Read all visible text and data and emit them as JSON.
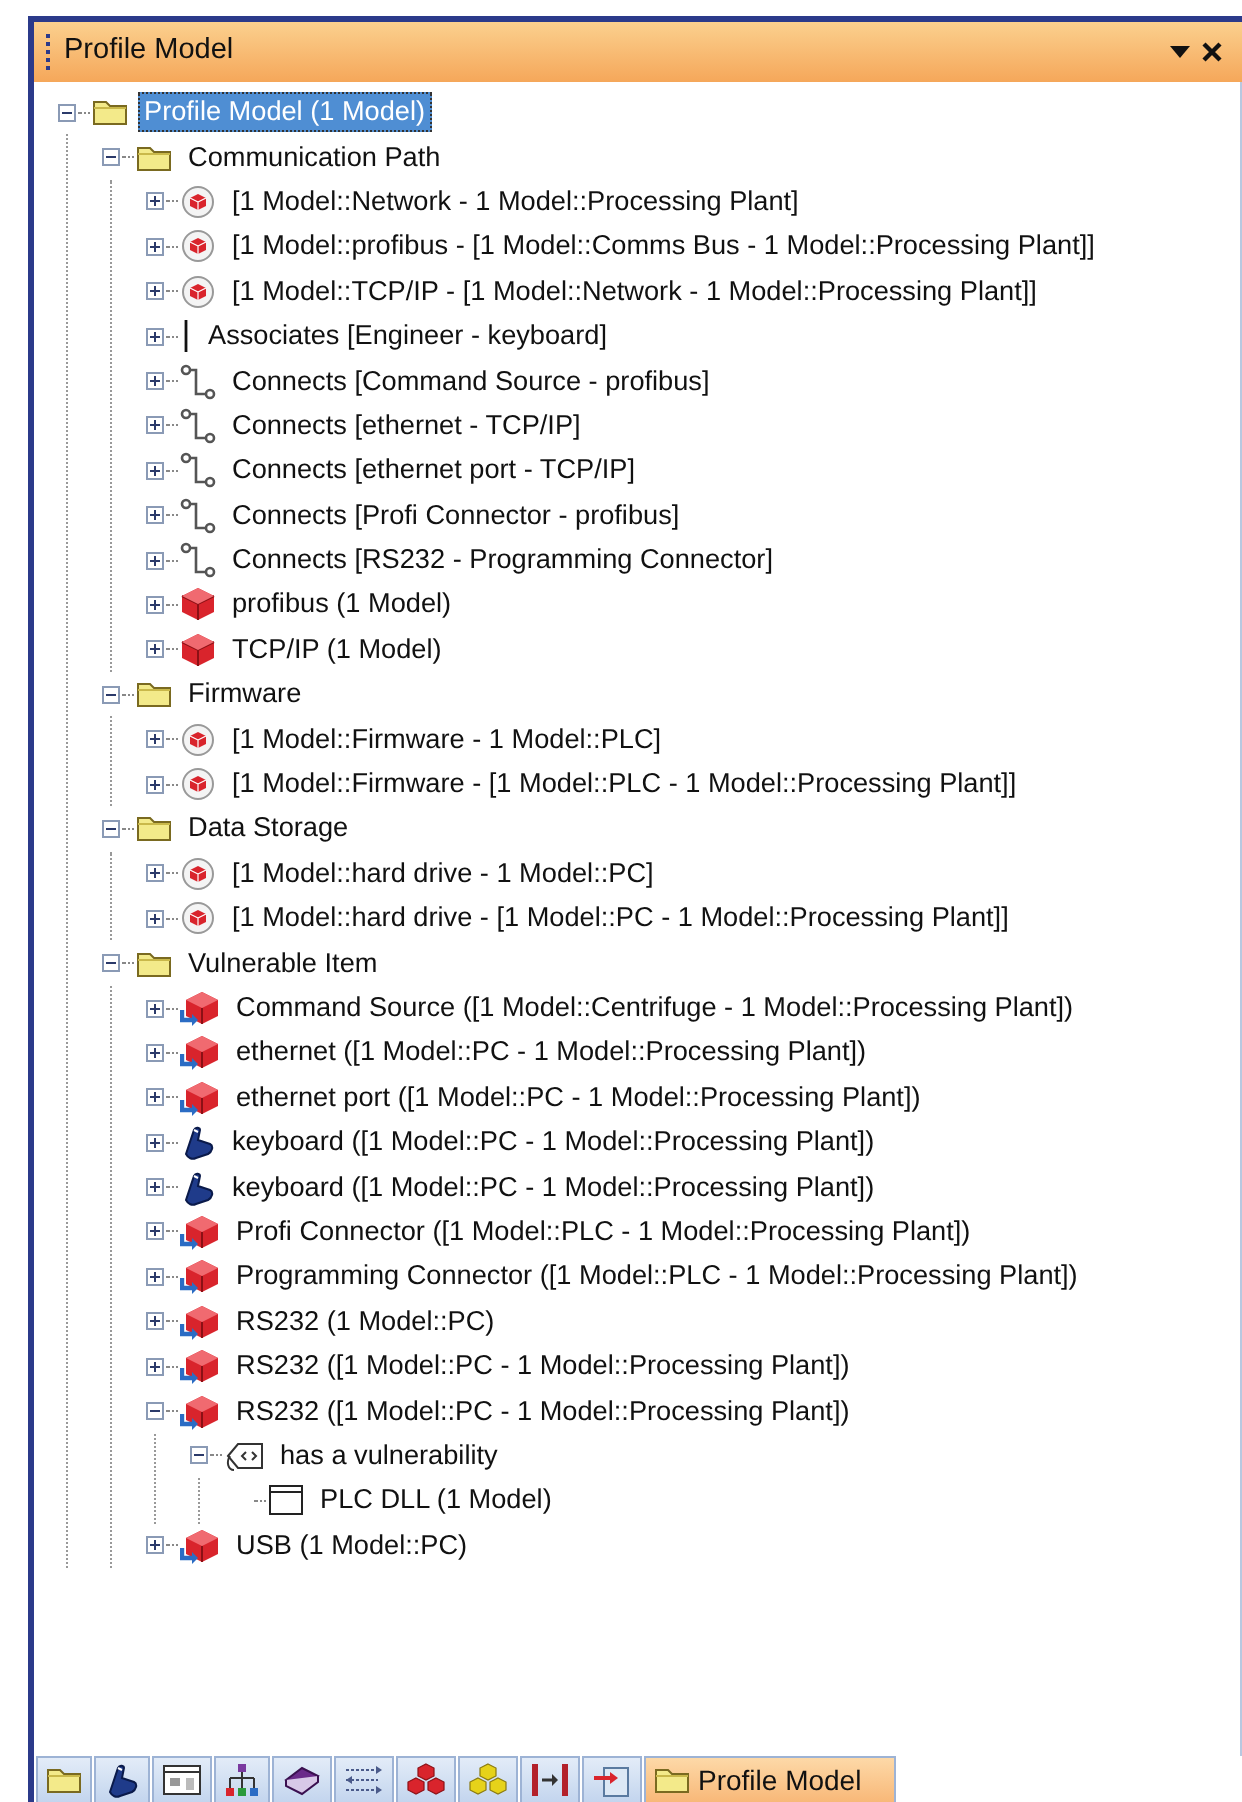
{
  "window": {
    "title": "Profile Model"
  },
  "tree": [
    {
      "label": "Profile Model (1 Model)",
      "kind": "folder",
      "expanded": true,
      "selected": true,
      "children": [
        {
          "label": "Communication Path",
          "kind": "folder",
          "expanded": true,
          "selected": false,
          "children": [
            {
              "label": "[1 Model::Network - 1 Model::Processing Plant]",
              "kind": "relation",
              "expanded": false,
              "selected": false
            },
            {
              "label": "[1 Model::profibus - [1 Model::Comms Bus - 1 Model::Processing Plant]]",
              "kind": "relation",
              "expanded": false,
              "selected": false
            },
            {
              "label": "[1 Model::TCP/IP - [1 Model::Network - 1 Model::Processing Plant]]",
              "kind": "relation",
              "expanded": false,
              "selected": false
            },
            {
              "label": "Associates [Engineer - keyboard]",
              "kind": "association",
              "expanded": false,
              "selected": false
            },
            {
              "label": "Connects [Command Source - profibus]",
              "kind": "connector",
              "expanded": false,
              "selected": false
            },
            {
              "label": "Connects [ethernet - TCP/IP]",
              "kind": "connector",
              "expanded": false,
              "selected": false
            },
            {
              "label": "Connects [ethernet port - TCP/IP]",
              "kind": "connector",
              "expanded": false,
              "selected": false
            },
            {
              "label": "Connects [Profi Connector - profibus]",
              "kind": "connector",
              "expanded": false,
              "selected": false
            },
            {
              "label": "Connects [RS232 - Programming Connector]",
              "kind": "connector",
              "expanded": false,
              "selected": false
            },
            {
              "label": "profibus (1 Model)",
              "kind": "block",
              "expanded": false,
              "selected": false
            },
            {
              "label": "TCP/IP (1 Model)",
              "kind": "block",
              "expanded": false,
              "selected": false
            }
          ]
        },
        {
          "label": "Firmware",
          "kind": "folder",
          "expanded": true,
          "selected": false,
          "children": [
            {
              "label": "[1 Model::Firmware - 1 Model::PLC]",
              "kind": "relation",
              "expanded": false,
              "selected": false
            },
            {
              "label": "[1 Model::Firmware - [1 Model::PLC - 1 Model::Processing Plant]]",
              "kind": "relation",
              "expanded": false,
              "selected": false
            }
          ]
        },
        {
          "label": "Data Storage",
          "kind": "folder",
          "expanded": true,
          "selected": false,
          "children": [
            {
              "label": "[1 Model::hard drive - 1 Model::PC]",
              "kind": "relation",
              "expanded": false,
              "selected": false
            },
            {
              "label": "[1 Model::hard drive - [1 Model::PC - 1 Model::Processing Plant]]",
              "kind": "relation",
              "expanded": false,
              "selected": false
            }
          ]
        },
        {
          "label": "Vulnerable Item",
          "kind": "folder",
          "expanded": true,
          "selected": false,
          "children": [
            {
              "label": "Command Source ([1 Model::Centrifuge - 1 Model::Processing Plant])",
              "kind": "part",
              "expanded": false,
              "selected": false
            },
            {
              "label": "ethernet ([1 Model::PC - 1 Model::Processing Plant])",
              "kind": "part",
              "expanded": false,
              "selected": false
            },
            {
              "label": "ethernet port ([1 Model::PC - 1 Model::Processing Plant])",
              "kind": "part",
              "expanded": false,
              "selected": false
            },
            {
              "label": "keyboard ([1 Model::PC - 1 Model::Processing Plant])",
              "kind": "hand",
              "expanded": false,
              "selected": false
            },
            {
              "label": "keyboard ([1 Model::PC - 1 Model::Processing Plant])",
              "kind": "hand",
              "expanded": false,
              "selected": false
            },
            {
              "label": "Profi Connector ([1 Model::PLC - 1 Model::Processing Plant])",
              "kind": "part",
              "expanded": false,
              "selected": false
            },
            {
              "label": "Programming Connector ([1 Model::PLC - 1 Model::Processing Plant])",
              "kind": "part",
              "expanded": false,
              "selected": false
            },
            {
              "label": "RS232 (1 Model::PC)",
              "kind": "part",
              "expanded": false,
              "selected": false
            },
            {
              "label": "RS232 ([1 Model::PC - 1 Model::Processing Plant])",
              "kind": "part",
              "expanded": false,
              "selected": false
            },
            {
              "label": "RS232 ([1 Model::PC - 1 Model::Processing Plant])",
              "kind": "part",
              "expanded": true,
              "selected": false,
              "children": [
                {
                  "label": "has a vulnerability",
                  "kind": "tag",
                  "expanded": true,
                  "selected": false,
                  "children": [
                    {
                      "label": "PLC DLL (1 Model)",
                      "kind": "document",
                      "selected": false
                    }
                  ]
                }
              ]
            },
            {
              "label": "USB (1 Model::PC)",
              "kind": "part",
              "expanded": false,
              "selected": false
            }
          ]
        }
      ]
    }
  ],
  "bottom_tabs": [
    {
      "kind": "folder",
      "selected": false
    },
    {
      "kind": "hand",
      "selected": false
    },
    {
      "kind": "window",
      "selected": false
    },
    {
      "kind": "hierarchy",
      "selected": false
    },
    {
      "kind": "book",
      "selected": false
    },
    {
      "kind": "arrows",
      "selected": false
    },
    {
      "kind": "red-cubes",
      "selected": false
    },
    {
      "kind": "yellow-cubes",
      "selected": false
    },
    {
      "kind": "bracket",
      "selected": false
    },
    {
      "kind": "import",
      "selected": false
    },
    {
      "kind": "folder",
      "label": "Profile Model",
      "selected": true
    }
  ]
}
